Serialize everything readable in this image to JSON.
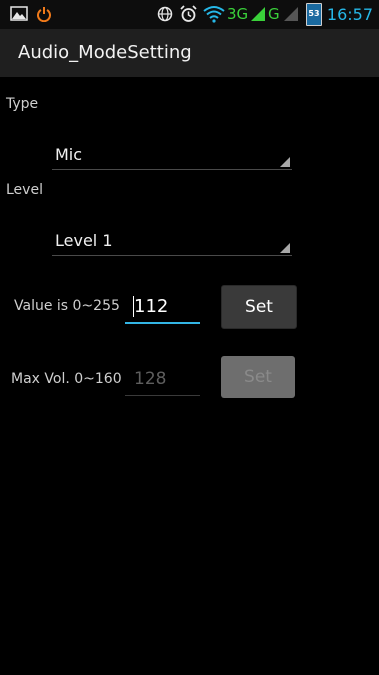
{
  "status_bar": {
    "network_3g": "3G",
    "network_g": "G",
    "battery": "53",
    "time": "16:57",
    "icons": [
      "image-icon",
      "power-icon",
      "globe-icon",
      "alarm-icon",
      "wifi-icon",
      "signal-icon",
      "battery-icon"
    ]
  },
  "action_bar": {
    "title": "Audio_ModeSetting"
  },
  "type_section": {
    "label": "Type",
    "selected": "Mic"
  },
  "level_section": {
    "label": "Level",
    "selected": "Level 1"
  },
  "value_row": {
    "label": "Value is 0~255",
    "value": "112",
    "button_label": "Set"
  },
  "max_vol_row": {
    "label": "Max Vol. 0~160",
    "value": "128",
    "button_label": "Set"
  },
  "colors": {
    "accent": "#33b5e5",
    "status_text": "#26b8e8",
    "background": "#000000",
    "action_bar": "#1f1f1f"
  }
}
